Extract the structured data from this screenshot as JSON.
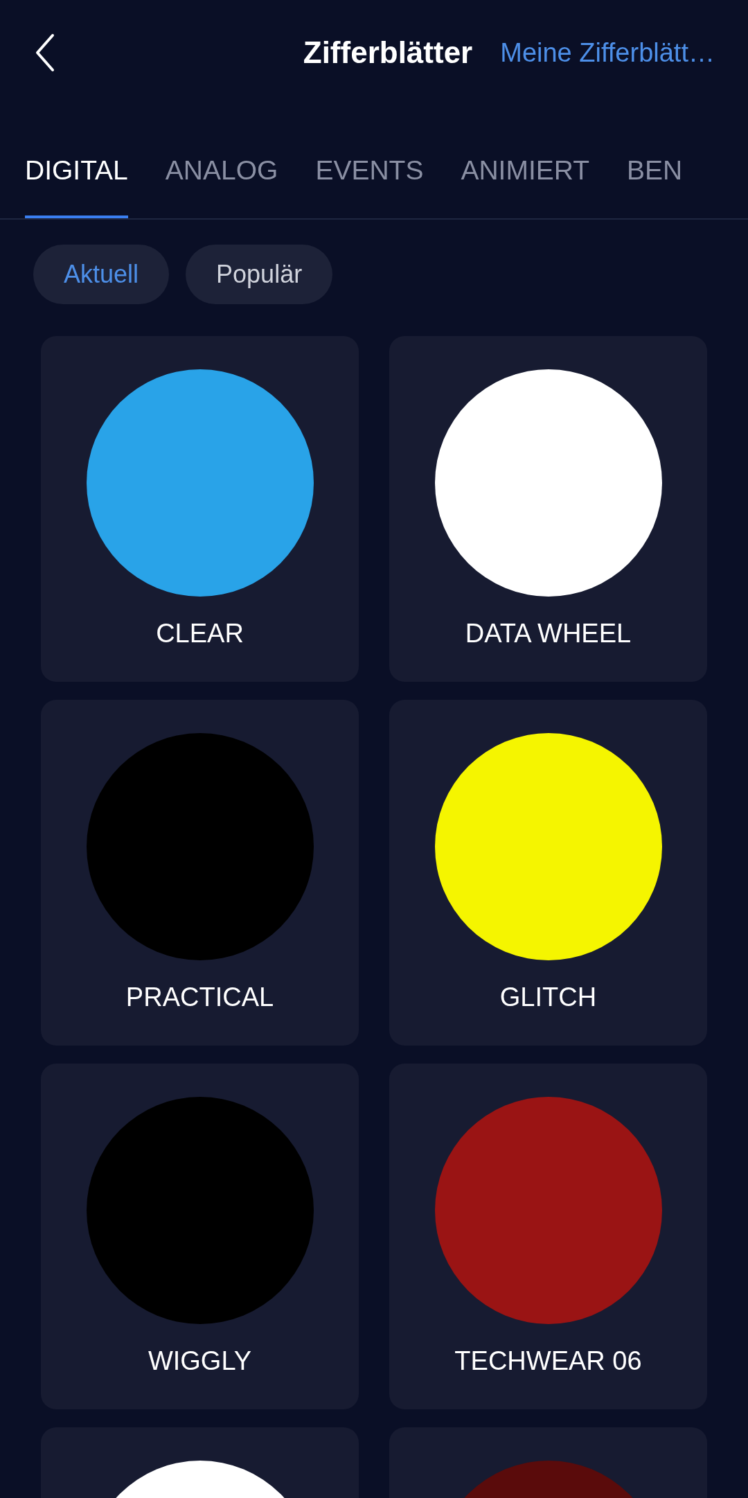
{
  "header": {
    "title": "Zifferblätter",
    "link": "Meine Zifferblätt…"
  },
  "tabs": [
    {
      "label": "DIGITAL",
      "selected": true
    },
    {
      "label": "ANALOG",
      "selected": false
    },
    {
      "label": "EVENTS",
      "selected": false
    },
    {
      "label": "ANIMIERT",
      "selected": false
    },
    {
      "label": "BEN",
      "selected": false
    }
  ],
  "filters": [
    {
      "label": "Aktuell",
      "selected": true
    },
    {
      "label": "Populär",
      "selected": false
    }
  ],
  "faces": [
    {
      "name": "CLEAR",
      "color": "#29a3e8"
    },
    {
      "name": "DATA WHEEL",
      "color": "#ffffff"
    },
    {
      "name": "PRACTICAL",
      "color": "#000000"
    },
    {
      "name": "GLITCH",
      "color": "#f5f500"
    },
    {
      "name": "WIGGLY",
      "color": "#000000"
    },
    {
      "name": "TECHWEAR 06",
      "color": "#9a1414"
    },
    {
      "color": "#ffffff"
    },
    {
      "color": "#5a0b0b"
    }
  ]
}
